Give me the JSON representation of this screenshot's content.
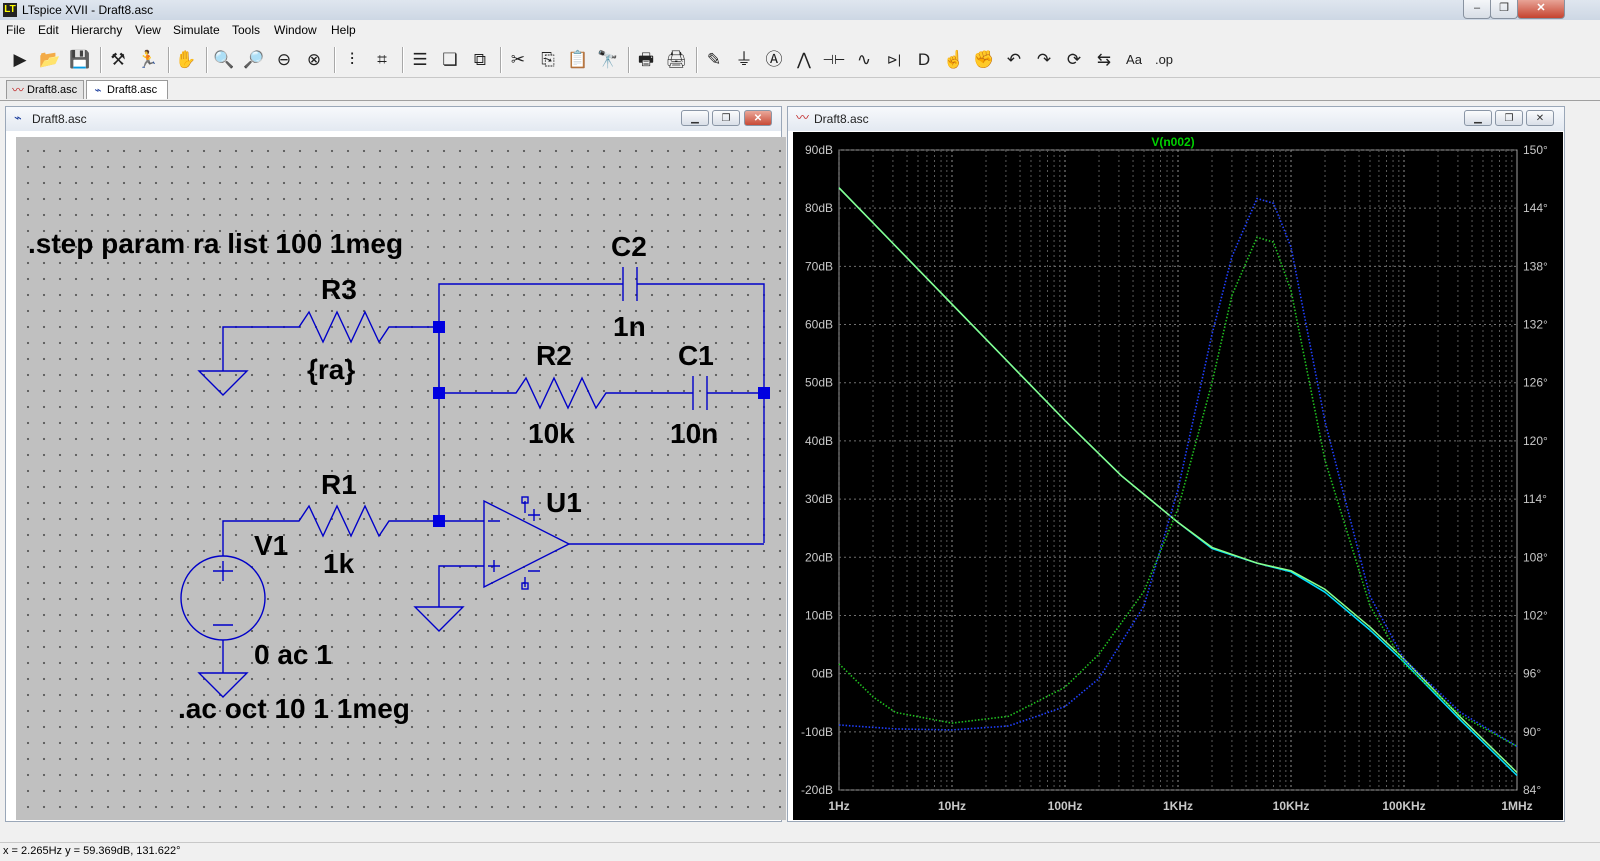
{
  "app": {
    "title": "LTspice XVII - Draft8.asc",
    "icon": "ltspice-icon"
  },
  "window_controls": {
    "minimize": "–",
    "restore": "❐",
    "close": "✕"
  },
  "menu": [
    "File",
    "Edit",
    "Hierarchy",
    "View",
    "Simulate",
    "Tools",
    "Window",
    "Help"
  ],
  "toolbar": [
    {
      "name": "open-schematic-icon",
      "glyph": "▶"
    },
    {
      "name": "open-file-icon",
      "glyph": "📂"
    },
    {
      "name": "save-icon",
      "glyph": "💾"
    },
    {
      "name": "control-panel-icon",
      "glyph": "⚒"
    },
    {
      "name": "run-icon",
      "glyph": "🏃"
    },
    {
      "name": "pan-hand-icon",
      "glyph": "✋"
    },
    {
      "name": "zoom-in-icon",
      "glyph": "🔍"
    },
    {
      "name": "zoom-out-icon",
      "glyph": "🔎"
    },
    {
      "name": "zoom-fit-icon",
      "glyph": "⊖"
    },
    {
      "name": "zoom-cancel-icon",
      "glyph": "⊗"
    },
    {
      "name": "autorange-icon",
      "glyph": "⫶"
    },
    {
      "name": "plot-settings-icon",
      "glyph": "⌗"
    },
    {
      "name": "tile-horizontal-icon",
      "glyph": "☰"
    },
    {
      "name": "cascade-icon",
      "glyph": "❏"
    },
    {
      "name": "tile-vertical-icon",
      "glyph": "⧉"
    },
    {
      "name": "cut-icon",
      "glyph": "✂"
    },
    {
      "name": "copy-icon",
      "glyph": "⎘"
    },
    {
      "name": "paste-icon",
      "glyph": "📋"
    },
    {
      "name": "find-icon",
      "glyph": "🔭"
    },
    {
      "name": "print-icon",
      "glyph": "🖶"
    },
    {
      "name": "print-preview-icon",
      "glyph": "🖨"
    },
    {
      "name": "draw-wire-icon",
      "glyph": "✎"
    },
    {
      "name": "ground-icon",
      "glyph": "⏚"
    },
    {
      "name": "label-net-icon",
      "glyph": "Ⓐ"
    },
    {
      "name": "resistor-icon",
      "glyph": "⋀"
    },
    {
      "name": "capacitor-icon",
      "glyph": "⊣⊢"
    },
    {
      "name": "inductor-icon",
      "glyph": "∿"
    },
    {
      "name": "diode-icon",
      "glyph": "⊳|"
    },
    {
      "name": "component-icon",
      "glyph": "D"
    },
    {
      "name": "move-icon",
      "glyph": "☝"
    },
    {
      "name": "drag-icon",
      "glyph": "✊"
    },
    {
      "name": "undo-icon",
      "glyph": "↶"
    },
    {
      "name": "redo-icon",
      "glyph": "↷"
    },
    {
      "name": "rotate-icon",
      "glyph": "⟳"
    },
    {
      "name": "mirror-icon",
      "glyph": "⇆"
    },
    {
      "name": "text-icon",
      "glyph": "Aa"
    },
    {
      "name": "spice-directive-icon",
      "glyph": ".op"
    }
  ],
  "tabs": [
    {
      "label": "Draft8.asc",
      "icon": "waveform-icon"
    },
    {
      "label": "Draft8.asc",
      "icon": "schematic-icon"
    }
  ],
  "schematic_window": {
    "title": "Draft8.asc",
    "texts": {
      "step_directive": ".step param ra list 100 1meg",
      "ac_directive": ".ac oct 10 1 1meg",
      "C2": "C2",
      "C2_value": "1n",
      "R3": "R3",
      "R3_value": "{ra}",
      "R2": "R2",
      "R2_value": "10k",
      "C1": "C1",
      "C1_value": "10n",
      "R1": "R1",
      "R1_value": "1k",
      "U1": "U1",
      "V1": "V1",
      "V1_value": "0 ac 1",
      "plus": "+",
      "minus": "−"
    }
  },
  "waveform_window": {
    "title": "Draft8.asc",
    "trace_label": "V(n002)"
  },
  "chart_data": {
    "type": "line",
    "title": "V(n002)",
    "x_scale": "log",
    "x_ticks": [
      "1Hz",
      "10Hz",
      "100Hz",
      "1KHz",
      "10KHz",
      "100KHz",
      "1MHz"
    ],
    "y_ticks_left": [
      "90dB",
      "80dB",
      "70dB",
      "60dB",
      "50dB",
      "40dB",
      "30dB",
      "20dB",
      "10dB",
      "0dB",
      "-10dB",
      "-20dB"
    ],
    "y_ticks_right": [
      "150°",
      "144°",
      "138°",
      "132°",
      "126°",
      "120°",
      "114°",
      "108°",
      "102°",
      "96°",
      "90°",
      "84°"
    ],
    "ylim_left": [
      -20,
      90
    ],
    "ylim_right": [
      84,
      150
    ],
    "grid": true,
    "colors": {
      "background": "#000000",
      "grid": "#808080",
      "axis_text": "#c0c0c0",
      "label": "#00d000",
      "magnitude_step1": "#00e0ff",
      "magnitude_step2": "#8aff8a",
      "phase_step1": "#2040ff",
      "phase_step2": "#20c020"
    },
    "series": [
      {
        "color": "#00e0ff",
        "style": "solid",
        "axis": "left",
        "x": [
          1,
          3.16,
          10,
          31.6,
          100,
          316,
          1000,
          2000,
          5000,
          10000,
          20000,
          50000,
          100000,
          316000,
          1000000
        ],
        "y": [
          83.5,
          73.5,
          63.5,
          53.5,
          43.5,
          34,
          26,
          21.5,
          19,
          17.5,
          14,
          7.5,
          2,
          -8,
          -17.5
        ]
      },
      {
        "color": "#8aff8a",
        "style": "solid",
        "axis": "left",
        "x": [
          1,
          3.16,
          10,
          31.6,
          100,
          316,
          1000,
          2000,
          5000,
          10000,
          20000,
          50000,
          100000,
          316000,
          1000000
        ],
        "y": [
          83.5,
          73.5,
          63.5,
          53.5,
          43.5,
          34,
          26,
          21.7,
          19,
          17.7,
          14.5,
          8,
          2.5,
          -7.5,
          -17
        ]
      },
      {
        "color": "#2040ff",
        "style": "dotted",
        "axis": "right",
        "x": [
          1,
          3.16,
          10,
          31.6,
          100,
          200,
          500,
          1000,
          2000,
          3000,
          5000,
          7000,
          10000,
          20000,
          50000,
          100000,
          316000,
          1000000
        ],
        "y": [
          90.7,
          90.3,
          90.2,
          90.6,
          92.6,
          95.5,
          103,
          115,
          131,
          139,
          145,
          144.5,
          140,
          122,
          104,
          97.5,
          92,
          88.5
        ]
      },
      {
        "color": "#20c020",
        "style": "dotted",
        "axis": "right",
        "x": [
          1,
          2,
          3.16,
          10,
          31.6,
          100,
          200,
          500,
          1000,
          2000,
          3000,
          5000,
          7000,
          10000,
          20000,
          50000,
          100000,
          316000,
          1000000
        ],
        "y": [
          97,
          93.6,
          92,
          90.9,
          91.6,
          94.6,
          98,
          104.5,
          113,
          126,
          135,
          141,
          140.5,
          135.5,
          118,
          103,
          97,
          91.7,
          88.5
        ]
      }
    ]
  },
  "status": {
    "text": "x = 2.265Hz    y = 59.369dB, 131.622°"
  }
}
